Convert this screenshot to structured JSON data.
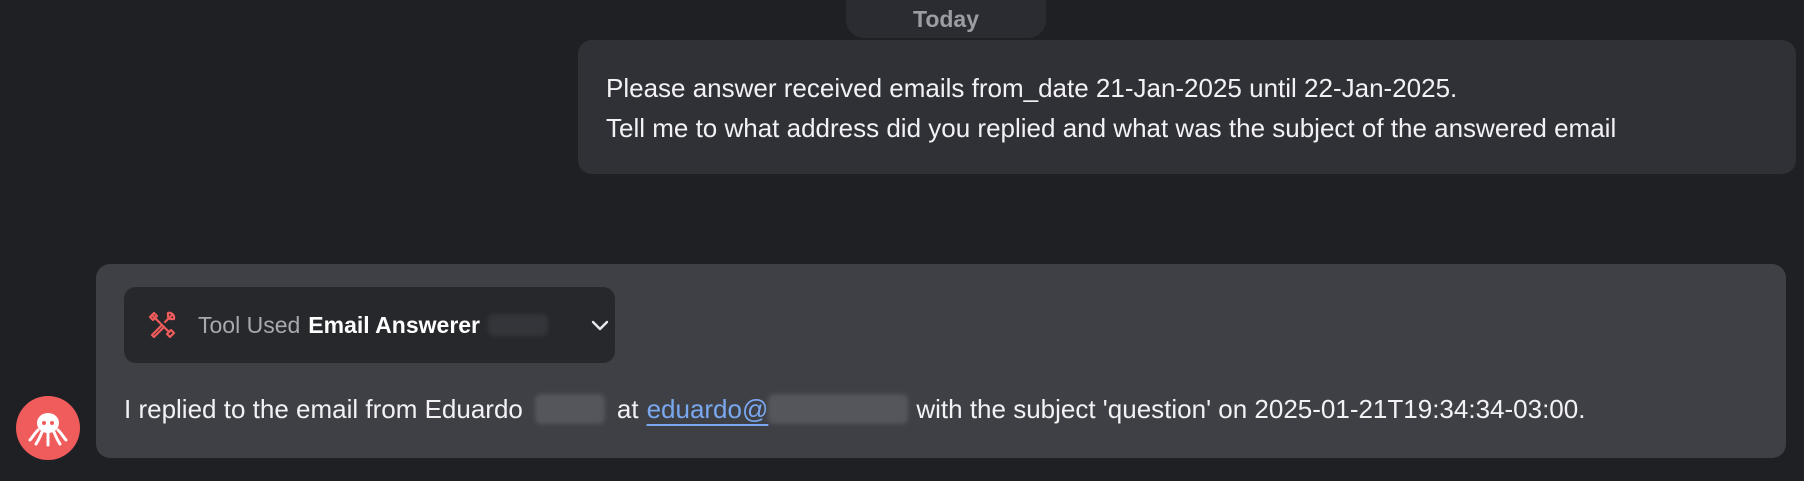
{
  "chat": {
    "date_separator": "Today",
    "user_message": {
      "line1": "Please answer received emails from_date 21-Jan-2025 until 22-Jan-2025.",
      "line2": "Tell me to what address did you replied and what was the subject of the answered email"
    },
    "assistant_message": {
      "tool_prefix": "Tool Used",
      "tool_name": "Email Answerer",
      "tool_icon": "tools-icon",
      "expand_icon": "chevron-down-icon",
      "reply_part1": "I replied to the email from Eduardo",
      "reply_part2": "at",
      "reply_email_visible": "eduardo@",
      "reply_part3": "with the subject 'question' on 2025-01-21T19:34:34-03:00.",
      "avatar_icon": "octopus-avatar-icon"
    }
  },
  "colors": {
    "background": "#1f2024",
    "user_bubble": "#303136",
    "assistant_bubble": "#3f4045",
    "tool_box": "#27282c",
    "tool_icon": "#f05b5b",
    "link": "#7aa8f0",
    "avatar": "#f05b5b"
  }
}
